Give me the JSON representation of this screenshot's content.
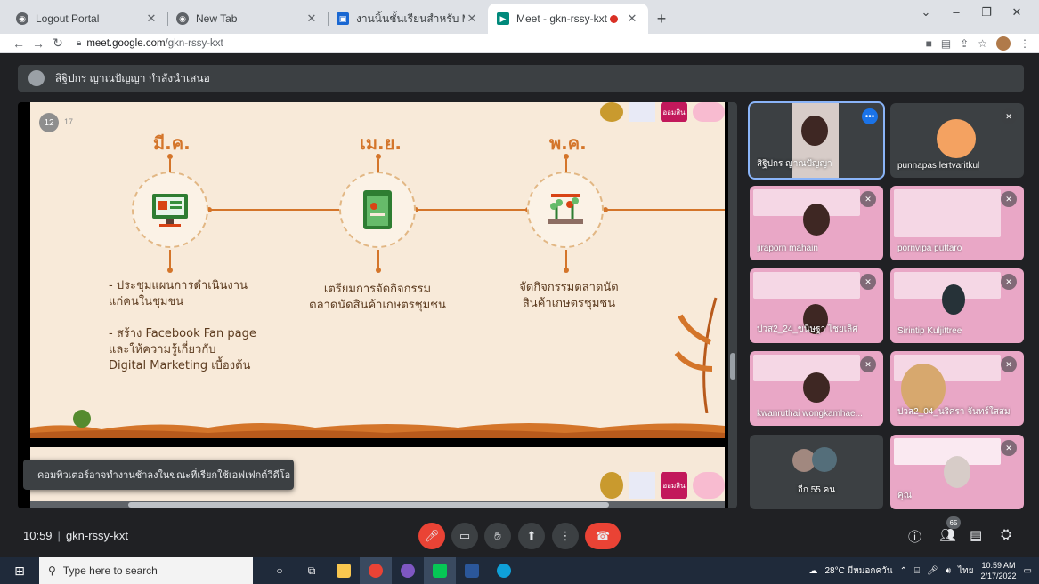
{
  "browser": {
    "tabs": [
      {
        "title": "Logout Portal",
        "favicon": "globe-icon",
        "active": false
      },
      {
        "title": "New Tab",
        "favicon": "chrome-icon",
        "active": false
      },
      {
        "title": "งานนิ้นชั้นเรียนสำหรับ Marketing Stra",
        "favicon": "classroom-icon",
        "active": false
      },
      {
        "title": "Meet - gkn-rssy-kxt",
        "favicon": "meet-icon",
        "active": true
      }
    ],
    "new_tab": "+",
    "url_host": "meet.google.com",
    "url_path": "/gkn-rssy-kxt",
    "window_controls": [
      "⌄",
      "–",
      "❐",
      "✕"
    ]
  },
  "meet": {
    "presenter_label": "สิฐิปกร ญาณปัญญา กำลังนำเสนอ",
    "toast": "คอมพิวเตอร์อาจทำงานช้าลงในขณะที่เรียกใช้เอฟเฟกต์วิดีโอ",
    "time": "10:59",
    "meeting_code": "gkn-rssy-kxt",
    "people_count": "65",
    "accent": "#1a73e8",
    "end_call_color": "#ea4335"
  },
  "slide": {
    "page": "12",
    "total": "17",
    "months": [
      "มี.ค.",
      "เม.ย.",
      "พ.ค."
    ],
    "col1_text_a": "- ประชุมแผนการดำเนินงาน",
    "col1_text_b": "แก่คนในชุมชน",
    "col1_text_c": "- สร้าง Facebook Fan page",
    "col1_text_d": "และให้ความรู้เกี่ยวกับ",
    "col1_text_e": "Digital Marketing เบื้องต้น",
    "col2_text_a": "เตรียมการจัดกิจกรรม",
    "col2_text_b": "ตลาดนัดสินค้าเกษตรชุมชน",
    "col3_text_a": "จัดกิจกรรมตลาดนัด",
    "col3_text_b": "สินค้าเกษตรชุมชน",
    "logo_text": "ออมสิน"
  },
  "participants": [
    {
      "name": "สิฐิปกร ญาณปัญญา",
      "muted": false,
      "type": "video"
    },
    {
      "name": "punnapas lertvaritkul",
      "muted": true,
      "type": "avatar"
    },
    {
      "name": "jiraporn mahain",
      "muted": true,
      "type": "video"
    },
    {
      "name": "pornvipa puttaro",
      "muted": true,
      "type": "video"
    },
    {
      "name": "ปวส2_24_ขนิษฐา ไชยเลิศ",
      "muted": true,
      "type": "video"
    },
    {
      "name": "Sirintip Kuljittree",
      "muted": true,
      "type": "video"
    },
    {
      "name": "kwanruthai wongkamhae...",
      "muted": true,
      "type": "video"
    },
    {
      "name": "ปวส2_04_นริศรา จันทร์ใสสม",
      "muted": true,
      "type": "video"
    },
    {
      "name": "อีก 55 คน",
      "muted": false,
      "type": "group"
    },
    {
      "name": "คุณ",
      "muted": true,
      "type": "video"
    }
  ],
  "taskbar": {
    "search_placeholder": "Type here to search",
    "weather": "28°C มีหมอกควัน",
    "lang": "ไทย",
    "clock_time": "10:59 AM",
    "clock_date": "2/17/2022",
    "notif_count": "2"
  }
}
